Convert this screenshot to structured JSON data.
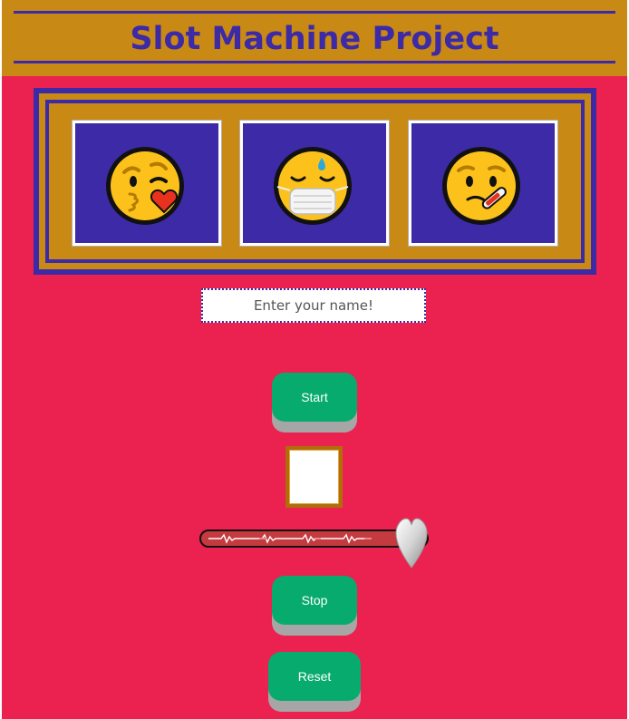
{
  "header": {
    "title": "Slot Machine Project"
  },
  "reels": [
    {
      "icon": "face-blowing-kiss-icon"
    },
    {
      "icon": "face-with-medical-mask-icon"
    },
    {
      "icon": "face-with-thermometer-icon"
    }
  ],
  "name_input": {
    "placeholder": "Enter your name!",
    "value": ""
  },
  "buttons": {
    "start": "Start",
    "stop": "Stop",
    "reset": "Reset"
  },
  "speed_slider": {
    "thumb_icon": "heart-icon",
    "level": 0.92
  },
  "colors": {
    "background": "#eb2150",
    "header": "#c98915",
    "accent_blue": "#3d2aa6",
    "button": "#08ab6e"
  }
}
